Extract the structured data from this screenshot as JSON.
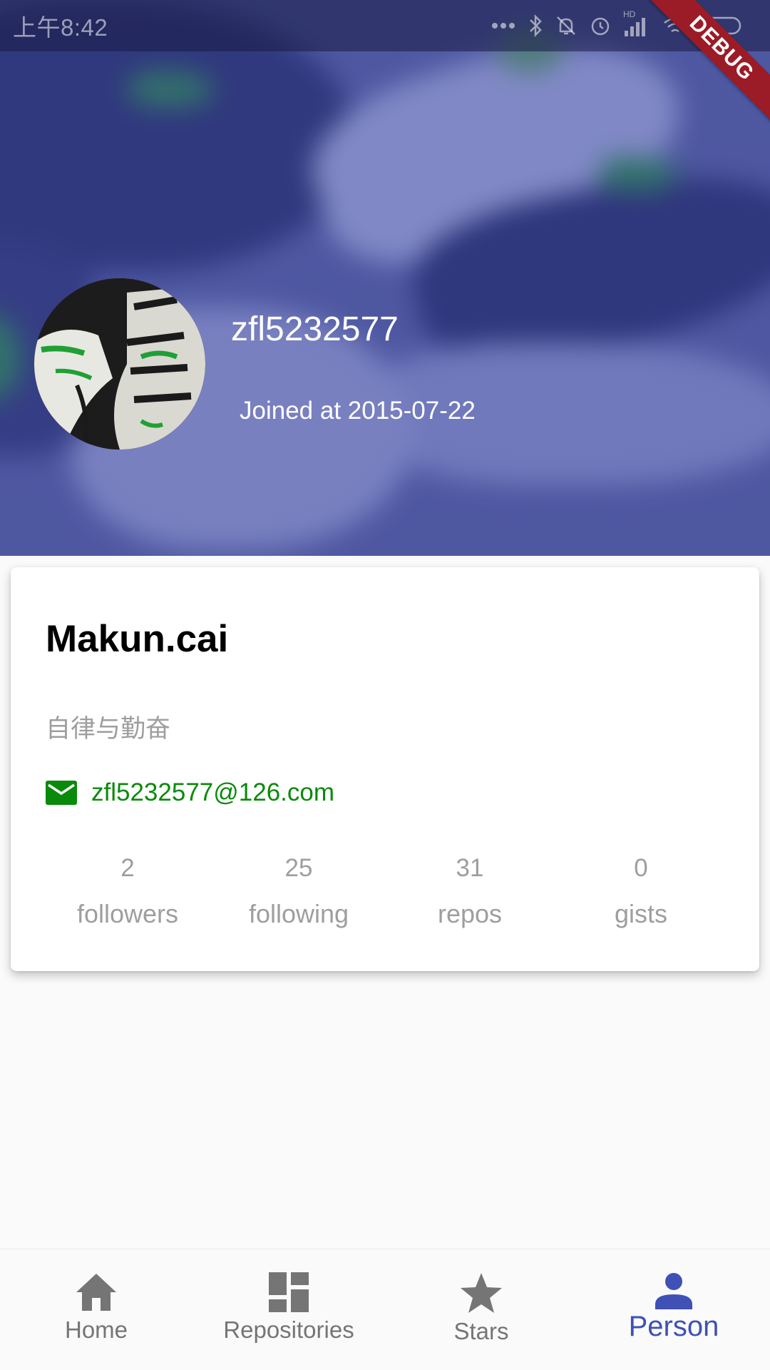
{
  "status_bar": {
    "time": "上午8:42",
    "hd_label": "HD"
  },
  "debug_banner": {
    "label": "DEBUG"
  },
  "profile_header": {
    "login": "zfl5232577",
    "joined": "Joined at 2015-07-22"
  },
  "profile_card": {
    "name": "Makun.cai",
    "bio": "自律与勤奋",
    "email": "zfl5232577@126.com",
    "email_icon": "mail-icon",
    "stats": [
      {
        "count": "2",
        "label": "followers"
      },
      {
        "count": "25",
        "label": "following"
      },
      {
        "count": "31",
        "label": "repos"
      },
      {
        "count": "0",
        "label": "gists"
      }
    ]
  },
  "bottom_nav": {
    "items": [
      {
        "label": "Home",
        "icon": "home-icon",
        "active": false
      },
      {
        "label": "Repositories",
        "icon": "dashboard-icon",
        "active": false
      },
      {
        "label": "Stars",
        "icon": "star-icon",
        "active": false
      },
      {
        "label": "Person",
        "icon": "person-icon",
        "active": true
      }
    ]
  },
  "colors": {
    "primary": "#3f51b5",
    "email_green": "#0a8a0a",
    "muted_text": "#9e9e9e",
    "inactive_nav": "#757575",
    "debug_red": "#9b1b26"
  }
}
